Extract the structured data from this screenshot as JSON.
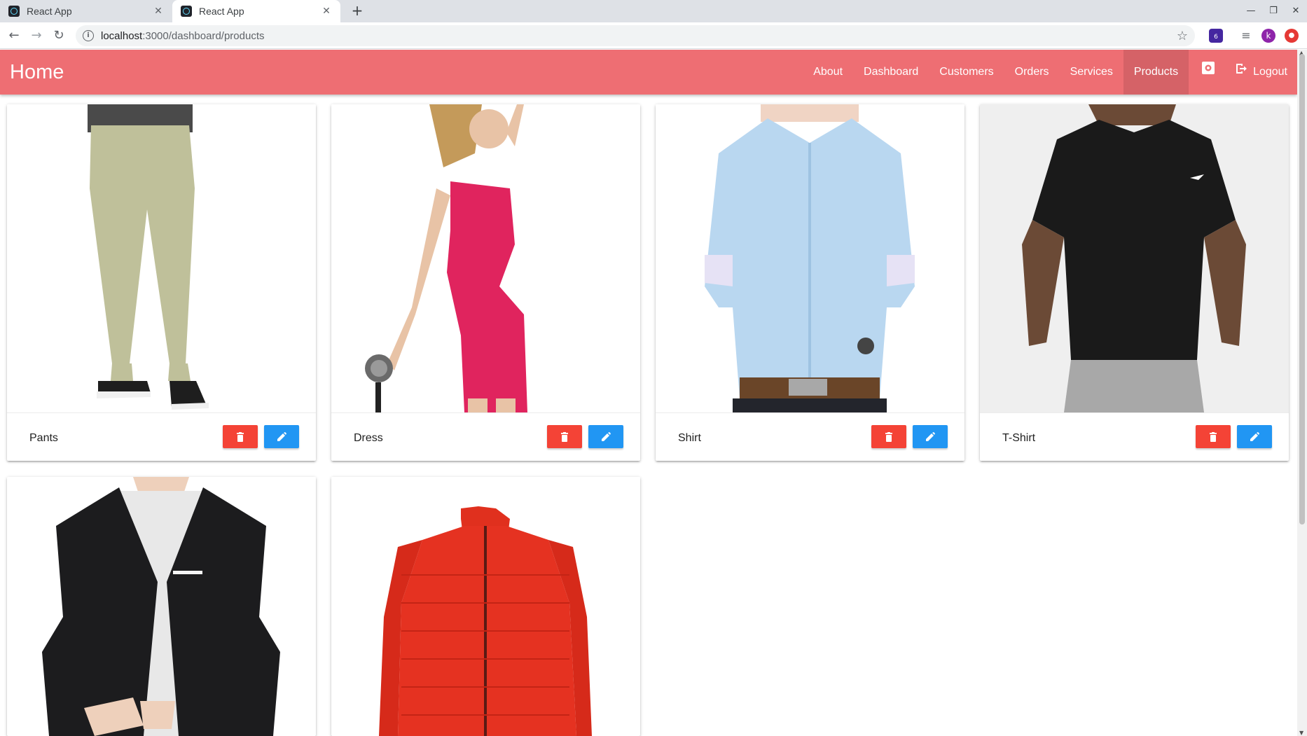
{
  "browser": {
    "tabs": [
      {
        "title": "React App",
        "active": false
      },
      {
        "title": "React App",
        "active": true
      }
    ],
    "url_host": "localhost",
    "url_path": ":3000/dashboard/products",
    "profile_initial": "k",
    "extension_badge": "6"
  },
  "app": {
    "brand": "Home",
    "accent_color": "#ee6e73",
    "nav": [
      {
        "label": "About",
        "active": false
      },
      {
        "label": "Dashboard",
        "active": false
      },
      {
        "label": "Customers",
        "active": false
      },
      {
        "label": "Orders",
        "active": false
      },
      {
        "label": "Services",
        "active": false
      },
      {
        "label": "Products",
        "active": true
      }
    ],
    "settings_icon": "gear-icon",
    "logout_label": "Logout",
    "logout_icon": "logout-icon"
  },
  "products": [
    {
      "name": "Pants",
      "image": "pants"
    },
    {
      "name": "Dress",
      "image": "dress"
    },
    {
      "name": "Shirt",
      "image": "shirt"
    },
    {
      "name": "T-Shirt",
      "image": "tshirt"
    },
    {
      "name": "",
      "image": "blazer"
    },
    {
      "name": "",
      "image": "jacket"
    }
  ],
  "colors": {
    "delete_button": "#f44336",
    "edit_button": "#2196f3"
  }
}
